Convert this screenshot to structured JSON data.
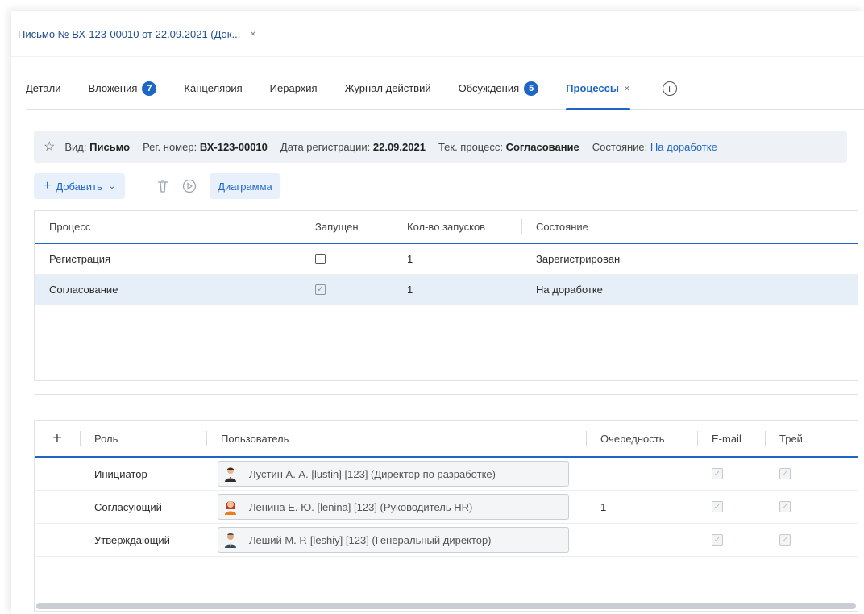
{
  "doc_tab": {
    "title": "Письмо № ВХ-123-00010 от 22.09.2021 (Док...",
    "close": "×"
  },
  "tabs": [
    {
      "label": "Детали"
    },
    {
      "label": "Вложения",
      "badge": "7"
    },
    {
      "label": "Канцелярия"
    },
    {
      "label": "Иерархия"
    },
    {
      "label": "Журнал действий"
    },
    {
      "label": "Обсуждения",
      "badge": "5"
    },
    {
      "label": "Процессы",
      "close": "×"
    }
  ],
  "info": {
    "kind_label": "Вид:",
    "kind_value": "Письмо",
    "reg_label": "Рег. номер:",
    "reg_value": "ВХ-123-00010",
    "date_label": "Дата регистрации:",
    "date_value": "22.09.2021",
    "process_label": "Тек. процесс:",
    "process_value": "Согласование",
    "state_label": "Состояние:",
    "state_value": "На доработке"
  },
  "toolbar": {
    "add_label": "Добавить",
    "diagram_label": "Диаграмма"
  },
  "process_grid": {
    "headers": {
      "process": "Процесс",
      "started": "Запущен",
      "count": "Кол-во запусков",
      "state": "Состояние"
    },
    "rows": [
      {
        "process": "Регистрация",
        "started": false,
        "count": "1",
        "state": "Зарегистрирован"
      },
      {
        "process": "Согласование",
        "started": true,
        "count": "1",
        "state": "На доработке"
      }
    ]
  },
  "role_grid": {
    "headers": {
      "role": "Роль",
      "user": "Пользователь",
      "order": "Очередность",
      "email": "E-mail",
      "tray": "Трей"
    },
    "rows": [
      {
        "role": "Инициатор",
        "user": "Лустин А. А. [lustin] [123] (Директор по разработке)",
        "order": "",
        "email": true,
        "tray": true
      },
      {
        "role": "Согласующий",
        "user": "Ленина Е. Ю. [lenina] [123] (Руководитель HR)",
        "order": "1",
        "email": true,
        "tray": true
      },
      {
        "role": "Утверждающий",
        "user": "Леший М. Р. [leshiy] [123] (Генеральный директор)",
        "order": "",
        "email": true,
        "tray": true
      }
    ]
  },
  "colors": {
    "accent": "#1e66c5",
    "selected_row": "#e6eef8",
    "infobar_bg": "#eef1f5"
  }
}
